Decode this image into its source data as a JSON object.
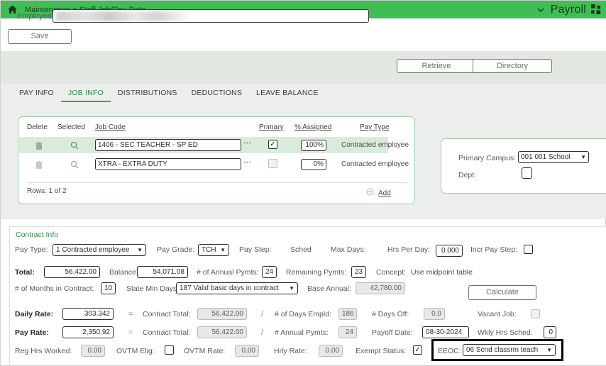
{
  "topbar": {
    "home_icon": "home-icon",
    "breadcrumb": "Maintenance > Staff Job/Pay Data",
    "chevron_icon": "chevron-down-icon",
    "app_name": "Payroll",
    "grid_icon": "grid-apps-icon"
  },
  "toolbar": {
    "save_label": "Save"
  },
  "employee": {
    "label": "Employee:",
    "value": "",
    "placeholder": "",
    "retrieve_label": "Retrieve",
    "directory_label": "Directory"
  },
  "tabs": [
    {
      "label": "PAY INFO",
      "active": false
    },
    {
      "label": "JOB INFO",
      "active": true
    },
    {
      "label": "DISTRIBUTIONS",
      "active": false
    },
    {
      "label": "DEDUCTIONS",
      "active": false
    },
    {
      "label": "LEAVE BALANCE",
      "active": false
    }
  ],
  "job_table": {
    "headers": {
      "delete": "Delete",
      "selected": "Selected",
      "job_code": "Job Code",
      "primary": "Primary",
      "percent_assigned": "% Assigned",
      "pay_type": "Pay Type"
    },
    "rows": [
      {
        "delete_icon": "trash-icon",
        "select_icon": "magnifier-icon",
        "job_code": "1406 - SEC TEACHER - SP ED",
        "kebab_icon": "kebab-menu-icon",
        "primary_checked": true,
        "percent_assigned": "100%",
        "pay_type": "Contracted employee",
        "highlighted": true
      },
      {
        "delete_icon": "trash-icon",
        "select_icon": "magnifier-icon",
        "job_code": "XTRA - EXTRA DUTY",
        "kebab_icon": "kebab-menu-icon",
        "primary_checked": false,
        "percent_assigned": "0%",
        "pay_type": "Contracted employee",
        "highlighted": false
      }
    ],
    "rows_text": "Rows: 1 of 2",
    "add_label": "Add",
    "add_icon": "plus-circle-icon"
  },
  "side_panel": {
    "primary_campus_label": "Primary Campus:",
    "primary_campus_value": "001 001 School",
    "dept_label": "Dept:",
    "dept_value": ""
  },
  "contract": {
    "title": "Contract Info",
    "pay_type_label": "Pay Type:",
    "pay_type_value": "1 Contracted employee",
    "pay_grade_label": "Pay Grade:",
    "pay_grade_value": "TCH",
    "pay_step_label": "Pay Step:",
    "pay_step_value": "",
    "sched_label": "Sched",
    "max_days_label": "Max Days:",
    "hrs_per_day_label": "Hrs Per Day:",
    "hrs_per_day_value": "0.000",
    "incr_pay_step_label": "Incr Pay Step:",
    "incr_pay_step_checked": false,
    "total_label": "Total:",
    "total_value": "56,422.00",
    "balance_label": "Balance:",
    "balance_value": "54,071.08",
    "annual_pymts_label": "# of Annual Pymts:",
    "annual_pymts_value": "24",
    "remaining_pymts_label": "Remaining Pymts:",
    "remaining_pymts_value": "23",
    "concept_label": "Concept:",
    "concept_value": "Use midpoint table",
    "months_in_contract_label": "# of Months in Contract:",
    "months_in_contract_value": "10",
    "state_min_days_label": "State Min Days:",
    "state_min_days_value": "187 Valid basic days in contract",
    "base_annual_label": "Base Annual:",
    "base_annual_value": "42,780.00",
    "calculate_label": "Calculate",
    "daily_rate_label": "Daily Rate:",
    "daily_rate_value": "303.342",
    "contract_total_label": "Contract Total:",
    "contract_total_value_1": "56,422.00",
    "days_empld_label": "# of Days Empld:",
    "days_empld_value": "186",
    "days_off_label": "# Days Off:",
    "days_off_value": "0.0",
    "vacant_job_label": "Vacant Job:",
    "vacant_job_checked": false,
    "pay_rate_label": "Pay Rate:",
    "pay_rate_value": "2,350.92",
    "contract_total_value_2": "56,422.00",
    "annual_pymts_label_2": "# Annual Pymts:",
    "annual_pymts_value_2": "24",
    "payoff_date_label": "Payoff Date:",
    "payoff_date_value": "08-30-2024",
    "wkly_hrs_sched_label": "Wkly Hrs Sched:",
    "wkly_hrs_sched_value": "0",
    "reg_hrs_worked_label": "Reg Hrs Worked:",
    "reg_hrs_worked_value": "0.00",
    "ovtm_elig_label": "OVTM Elig:",
    "ovtm_elig_checked": false,
    "ovtm_rate_label": "OVTM Rate:",
    "ovtm_rate_value": "0.00",
    "hrly_rate_label": "Hrly Rate:",
    "hrly_rate_value": "0.00",
    "exempt_status_label": "Exempt Status:",
    "exempt_status_checked": true,
    "eeoc_label": "EEOC:",
    "eeoc_value": "06 Scnd classrm teach",
    "equals_sign": "=",
    "divide_sign": "/"
  },
  "colors": {
    "brand_green": "#3fbe55",
    "accent_green": "#2f8b46",
    "band_gray": "#e2e8e1",
    "tab_bg": "#eceeeb",
    "row_highlight": "#d9ecdc",
    "highlight_box": "#000000"
  }
}
